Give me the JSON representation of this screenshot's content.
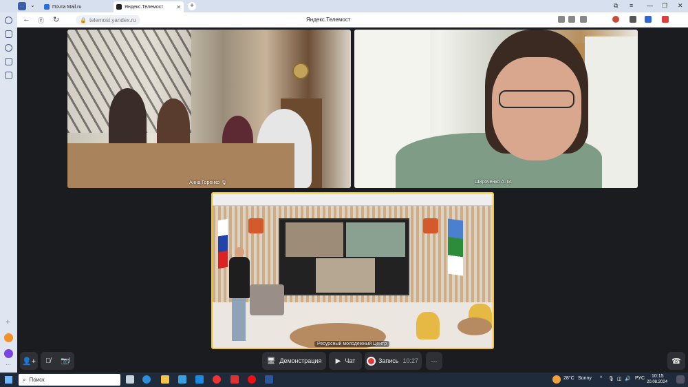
{
  "browser": {
    "tabs": [
      {
        "label": "Почта Mail.ru",
        "active": false
      },
      {
        "label": "Яндекс.Телемост",
        "active": true
      }
    ],
    "url": "telemost.yandex.ru",
    "page_title": "Яндекс.Телемост",
    "colors": {
      "tabbar": "#d7e0ee",
      "accent": "#f2c331"
    }
  },
  "participants": [
    {
      "name": "Анна Горенко",
      "muted": true
    },
    {
      "name": "Широченко А. М."
    },
    {
      "name": "Ресурсный молодежный Центр",
      "speaking": true
    }
  ],
  "controls": {
    "add_participant_icon": "add-person-icon",
    "mic_icon": "mic-off-icon",
    "camera_icon": "camera-off-icon",
    "screen_share": "Демонстрация",
    "chat": "Чат",
    "record": "Запись",
    "record_time": "10:27",
    "more": "⋯",
    "hangup_icon": "phone-hangup-icon"
  },
  "taskbar": {
    "search": "Поиск",
    "weather": "28°C",
    "weather_text": "Sunny",
    "lang": "РУС",
    "time": "10:15",
    "date": "20.08.2024"
  }
}
